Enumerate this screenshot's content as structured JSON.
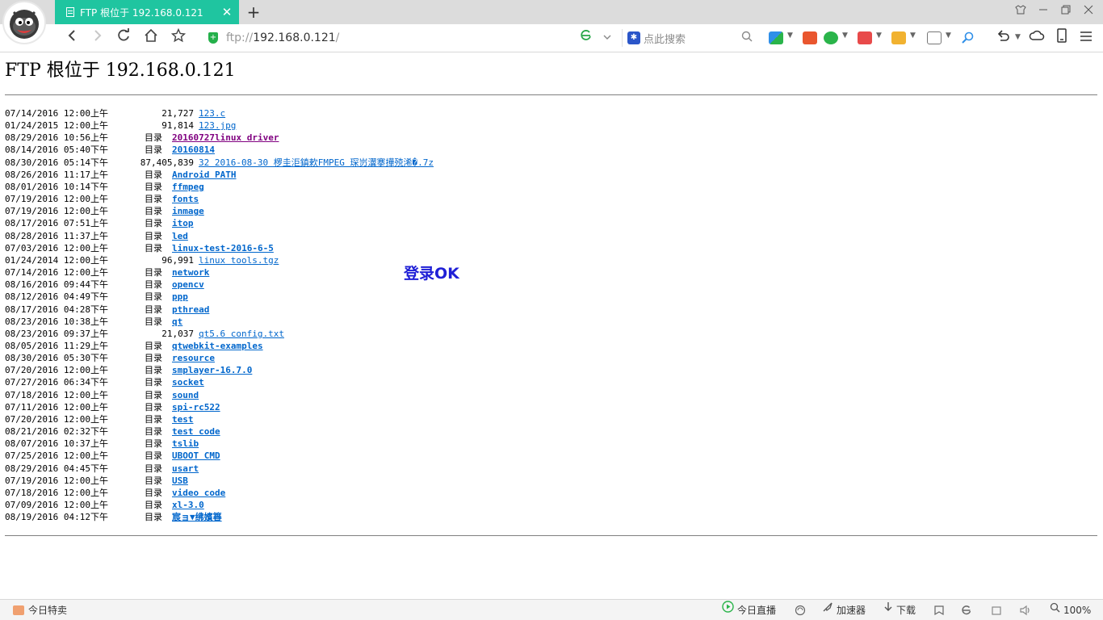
{
  "browser": {
    "tab_title": "FTP 根位于 192.168.0.121",
    "tab_close": "✕",
    "new_tab": "+",
    "url_scheme": "ftp://",
    "url_host": "192.168.0.121",
    "url_path": "/",
    "search_placeholder": "点此搜索"
  },
  "page": {
    "heading": "FTP 根位于 192.168.0.121",
    "dir_label": "目录",
    "overlay": "登录OK",
    "entries": [
      {
        "date": "07/14/2016 12:00上午",
        "size": "21,727",
        "dir": "",
        "name": "123.c"
      },
      {
        "date": "01/24/2015 12:00上午",
        "size": "91,814",
        "dir": "",
        "name": "123.jpg"
      },
      {
        "date": "08/29/2016 10:56上午",
        "size": "",
        "dir": "目录",
        "name": "20160727linux driver"
      },
      {
        "date": "08/14/2016 05:40下午",
        "size": "",
        "dir": "目录",
        "name": "20160814"
      },
      {
        "date": "08/30/2016 05:14下午",
        "size": "87,405,839",
        "dir": "",
        "name": "32 2016-08-30 椤圭洰鎮欶FMPEG 琛岃瀷搴撶殑浠�.7z"
      },
      {
        "date": "08/26/2016 11:17上午",
        "size": "",
        "dir": "目录",
        "name": "Android PATH"
      },
      {
        "date": "08/01/2016 10:14下午",
        "size": "",
        "dir": "目录",
        "name": "ffmpeg"
      },
      {
        "date": "07/19/2016 12:00上午",
        "size": "",
        "dir": "目录",
        "name": "fonts"
      },
      {
        "date": "07/19/2016 12:00上午",
        "size": "",
        "dir": "目录",
        "name": "inmage"
      },
      {
        "date": "08/17/2016 07:51上午",
        "size": "",
        "dir": "目录",
        "name": "itop"
      },
      {
        "date": "08/28/2016 11:37上午",
        "size": "",
        "dir": "目录",
        "name": "led"
      },
      {
        "date": "07/03/2016 12:00上午",
        "size": "",
        "dir": "目录",
        "name": "linux-test-2016-6-5"
      },
      {
        "date": "01/24/2014 12:00上午",
        "size": "96,991",
        "dir": "",
        "name": "linux tools.tgz"
      },
      {
        "date": "07/14/2016 12:00上午",
        "size": "",
        "dir": "目录",
        "name": "network"
      },
      {
        "date": "08/16/2016 09:44下午",
        "size": "",
        "dir": "目录",
        "name": "opencv"
      },
      {
        "date": "08/12/2016 04:49下午",
        "size": "",
        "dir": "目录",
        "name": "ppp"
      },
      {
        "date": "08/17/2016 04:28下午",
        "size": "",
        "dir": "目录",
        "name": "pthread"
      },
      {
        "date": "08/23/2016 10:38上午",
        "size": "",
        "dir": "目录",
        "name": "qt"
      },
      {
        "date": "08/23/2016 09:37上午",
        "size": "21,037",
        "dir": "",
        "name": "qt5.6 config.txt"
      },
      {
        "date": "08/05/2016 11:29上午",
        "size": "",
        "dir": "目录",
        "name": "qtwebkit-examples"
      },
      {
        "date": "08/30/2016 05:30下午",
        "size": "",
        "dir": "目录",
        "name": "resource"
      },
      {
        "date": "07/20/2016 12:00上午",
        "size": "",
        "dir": "目录",
        "name": "smplayer-16.7.0"
      },
      {
        "date": "07/27/2016 06:34下午",
        "size": "",
        "dir": "目录",
        "name": "socket"
      },
      {
        "date": "07/18/2016 12:00上午",
        "size": "",
        "dir": "目录",
        "name": "sound"
      },
      {
        "date": "07/11/2016 12:00上午",
        "size": "",
        "dir": "目录",
        "name": "spi-rc522"
      },
      {
        "date": "07/20/2016 12:00上午",
        "size": "",
        "dir": "目录",
        "name": "test"
      },
      {
        "date": "08/21/2016 02:32下午",
        "size": "",
        "dir": "目录",
        "name": "test code"
      },
      {
        "date": "08/07/2016 10:37上午",
        "size": "",
        "dir": "目录",
        "name": "tslib"
      },
      {
        "date": "07/25/2016 12:00上午",
        "size": "",
        "dir": "目录",
        "name": "UBOOT CMD"
      },
      {
        "date": "08/29/2016 04:45下午",
        "size": "",
        "dir": "目录",
        "name": "usart"
      },
      {
        "date": "07/19/2016 12:00上午",
        "size": "",
        "dir": "目录",
        "name": "USB"
      },
      {
        "date": "07/18/2016 12:00上午",
        "size": "",
        "dir": "目录",
        "name": "video code"
      },
      {
        "date": "07/09/2016 12:00上午",
        "size": "",
        "dir": "目录",
        "name": "xl-3.0"
      },
      {
        "date": "08/19/2016 04:12下午",
        "size": "",
        "dir": "目录",
        "name": "宸ョ▼绋嬪簭"
      }
    ]
  },
  "statusbar": {
    "left": "今日特卖",
    "live": "今日直播",
    "accelerator": "加速器",
    "download": "下载",
    "zoom": "100%"
  },
  "colors": {
    "tab_active": "#1fc5a0",
    "link": "#0066cc",
    "visited_link": "#800080",
    "overlay_text": "#1f1fd6"
  }
}
